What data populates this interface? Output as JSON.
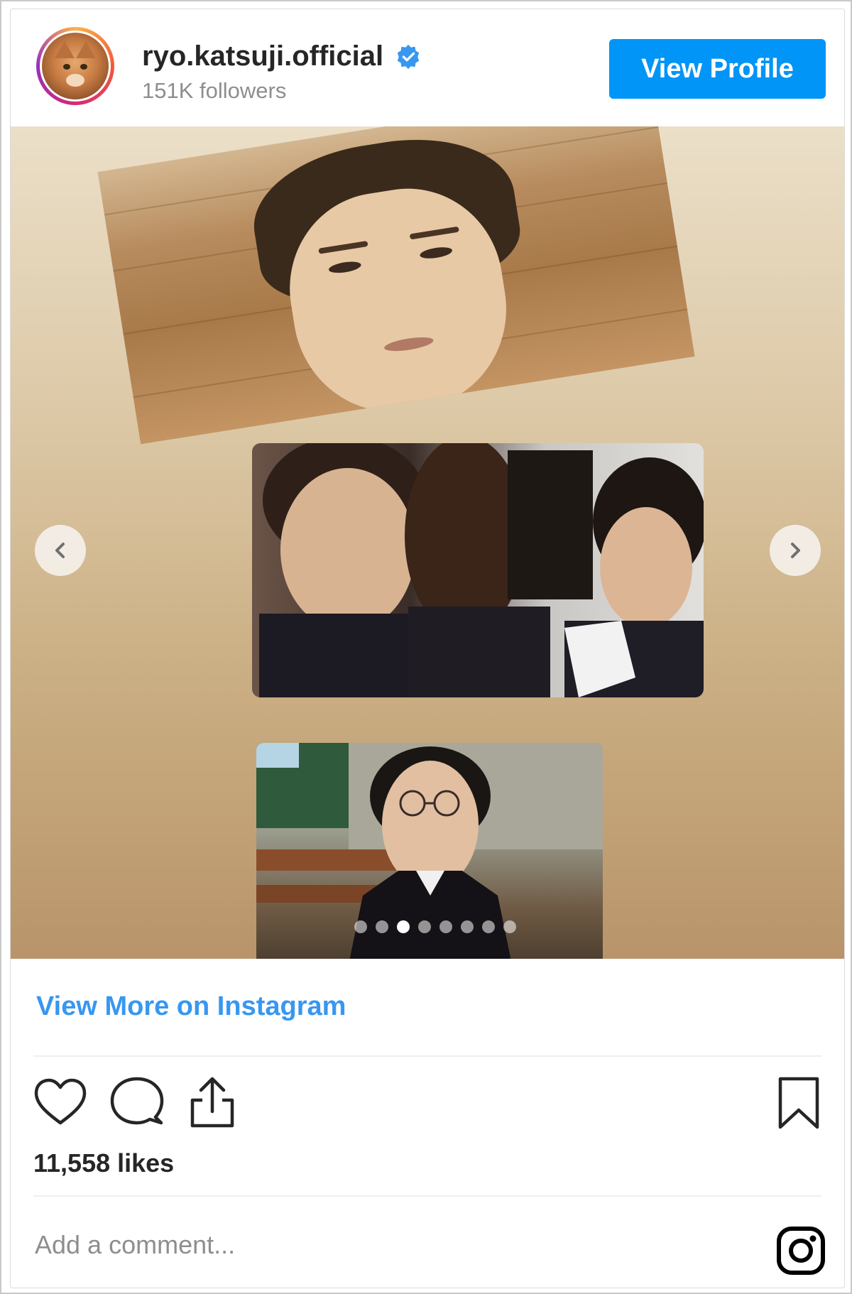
{
  "profile": {
    "username": "ryo.katsuji.official",
    "followers": "151K followers",
    "view_profile_label": "View Profile",
    "verified": true
  },
  "carousel": {
    "slide_count": 8,
    "active_index": 2
  },
  "footer": {
    "view_more_label": "View More on Instagram",
    "likes": "11,558 likes",
    "comment_placeholder": "Add a comment..."
  },
  "icons": {
    "avatar": "cat-avatar",
    "verified": "verified-badge-icon",
    "prev": "chevron-left-icon",
    "next": "chevron-right-icon",
    "like": "heart-icon",
    "comment": "comment-icon",
    "share": "share-icon",
    "save": "bookmark-icon",
    "instagram": "instagram-icon"
  },
  "colors": {
    "accent": "#0095f6",
    "link": "#3897f0",
    "verified": "#3897f0"
  }
}
